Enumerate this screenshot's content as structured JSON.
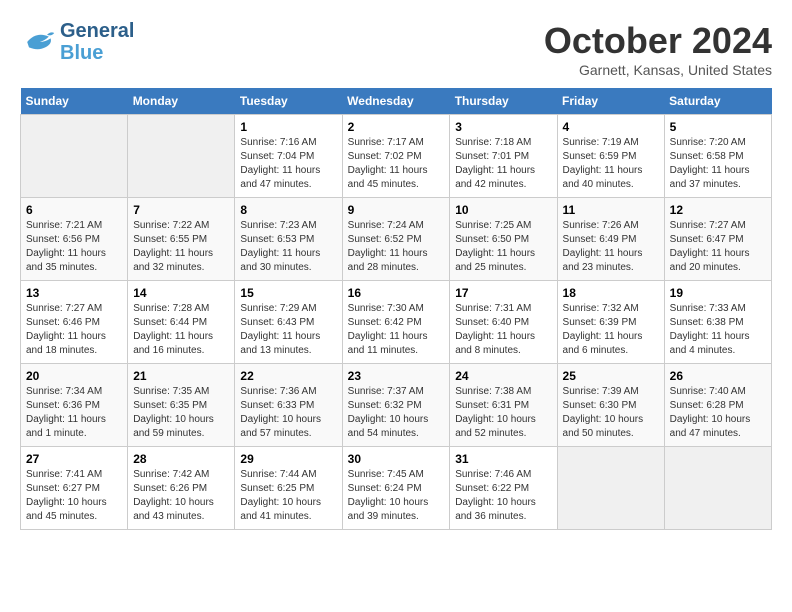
{
  "header": {
    "logo": {
      "line1": "General",
      "line2": "Blue"
    },
    "title": "October 2024",
    "location": "Garnett, Kansas, United States"
  },
  "days_of_week": [
    "Sunday",
    "Monday",
    "Tuesday",
    "Wednesday",
    "Thursday",
    "Friday",
    "Saturday"
  ],
  "weeks": [
    [
      {
        "day": "",
        "sunrise": "",
        "sunset": "",
        "daylight": ""
      },
      {
        "day": "",
        "sunrise": "",
        "sunset": "",
        "daylight": ""
      },
      {
        "day": "1",
        "sunrise": "Sunrise: 7:16 AM",
        "sunset": "Sunset: 7:04 PM",
        "daylight": "Daylight: 11 hours and 47 minutes."
      },
      {
        "day": "2",
        "sunrise": "Sunrise: 7:17 AM",
        "sunset": "Sunset: 7:02 PM",
        "daylight": "Daylight: 11 hours and 45 minutes."
      },
      {
        "day": "3",
        "sunrise": "Sunrise: 7:18 AM",
        "sunset": "Sunset: 7:01 PM",
        "daylight": "Daylight: 11 hours and 42 minutes."
      },
      {
        "day": "4",
        "sunrise": "Sunrise: 7:19 AM",
        "sunset": "Sunset: 6:59 PM",
        "daylight": "Daylight: 11 hours and 40 minutes."
      },
      {
        "day": "5",
        "sunrise": "Sunrise: 7:20 AM",
        "sunset": "Sunset: 6:58 PM",
        "daylight": "Daylight: 11 hours and 37 minutes."
      }
    ],
    [
      {
        "day": "6",
        "sunrise": "Sunrise: 7:21 AM",
        "sunset": "Sunset: 6:56 PM",
        "daylight": "Daylight: 11 hours and 35 minutes."
      },
      {
        "day": "7",
        "sunrise": "Sunrise: 7:22 AM",
        "sunset": "Sunset: 6:55 PM",
        "daylight": "Daylight: 11 hours and 32 minutes."
      },
      {
        "day": "8",
        "sunrise": "Sunrise: 7:23 AM",
        "sunset": "Sunset: 6:53 PM",
        "daylight": "Daylight: 11 hours and 30 minutes."
      },
      {
        "day": "9",
        "sunrise": "Sunrise: 7:24 AM",
        "sunset": "Sunset: 6:52 PM",
        "daylight": "Daylight: 11 hours and 28 minutes."
      },
      {
        "day": "10",
        "sunrise": "Sunrise: 7:25 AM",
        "sunset": "Sunset: 6:50 PM",
        "daylight": "Daylight: 11 hours and 25 minutes."
      },
      {
        "day": "11",
        "sunrise": "Sunrise: 7:26 AM",
        "sunset": "Sunset: 6:49 PM",
        "daylight": "Daylight: 11 hours and 23 minutes."
      },
      {
        "day": "12",
        "sunrise": "Sunrise: 7:27 AM",
        "sunset": "Sunset: 6:47 PM",
        "daylight": "Daylight: 11 hours and 20 minutes."
      }
    ],
    [
      {
        "day": "13",
        "sunrise": "Sunrise: 7:27 AM",
        "sunset": "Sunset: 6:46 PM",
        "daylight": "Daylight: 11 hours and 18 minutes."
      },
      {
        "day": "14",
        "sunrise": "Sunrise: 7:28 AM",
        "sunset": "Sunset: 6:44 PM",
        "daylight": "Daylight: 11 hours and 16 minutes."
      },
      {
        "day": "15",
        "sunrise": "Sunrise: 7:29 AM",
        "sunset": "Sunset: 6:43 PM",
        "daylight": "Daylight: 11 hours and 13 minutes."
      },
      {
        "day": "16",
        "sunrise": "Sunrise: 7:30 AM",
        "sunset": "Sunset: 6:42 PM",
        "daylight": "Daylight: 11 hours and 11 minutes."
      },
      {
        "day": "17",
        "sunrise": "Sunrise: 7:31 AM",
        "sunset": "Sunset: 6:40 PM",
        "daylight": "Daylight: 11 hours and 8 minutes."
      },
      {
        "day": "18",
        "sunrise": "Sunrise: 7:32 AM",
        "sunset": "Sunset: 6:39 PM",
        "daylight": "Daylight: 11 hours and 6 minutes."
      },
      {
        "day": "19",
        "sunrise": "Sunrise: 7:33 AM",
        "sunset": "Sunset: 6:38 PM",
        "daylight": "Daylight: 11 hours and 4 minutes."
      }
    ],
    [
      {
        "day": "20",
        "sunrise": "Sunrise: 7:34 AM",
        "sunset": "Sunset: 6:36 PM",
        "daylight": "Daylight: 11 hours and 1 minute."
      },
      {
        "day": "21",
        "sunrise": "Sunrise: 7:35 AM",
        "sunset": "Sunset: 6:35 PM",
        "daylight": "Daylight: 10 hours and 59 minutes."
      },
      {
        "day": "22",
        "sunrise": "Sunrise: 7:36 AM",
        "sunset": "Sunset: 6:33 PM",
        "daylight": "Daylight: 10 hours and 57 minutes."
      },
      {
        "day": "23",
        "sunrise": "Sunrise: 7:37 AM",
        "sunset": "Sunset: 6:32 PM",
        "daylight": "Daylight: 10 hours and 54 minutes."
      },
      {
        "day": "24",
        "sunrise": "Sunrise: 7:38 AM",
        "sunset": "Sunset: 6:31 PM",
        "daylight": "Daylight: 10 hours and 52 minutes."
      },
      {
        "day": "25",
        "sunrise": "Sunrise: 7:39 AM",
        "sunset": "Sunset: 6:30 PM",
        "daylight": "Daylight: 10 hours and 50 minutes."
      },
      {
        "day": "26",
        "sunrise": "Sunrise: 7:40 AM",
        "sunset": "Sunset: 6:28 PM",
        "daylight": "Daylight: 10 hours and 47 minutes."
      }
    ],
    [
      {
        "day": "27",
        "sunrise": "Sunrise: 7:41 AM",
        "sunset": "Sunset: 6:27 PM",
        "daylight": "Daylight: 10 hours and 45 minutes."
      },
      {
        "day": "28",
        "sunrise": "Sunrise: 7:42 AM",
        "sunset": "Sunset: 6:26 PM",
        "daylight": "Daylight: 10 hours and 43 minutes."
      },
      {
        "day": "29",
        "sunrise": "Sunrise: 7:44 AM",
        "sunset": "Sunset: 6:25 PM",
        "daylight": "Daylight: 10 hours and 41 minutes."
      },
      {
        "day": "30",
        "sunrise": "Sunrise: 7:45 AM",
        "sunset": "Sunset: 6:24 PM",
        "daylight": "Daylight: 10 hours and 39 minutes."
      },
      {
        "day": "31",
        "sunrise": "Sunrise: 7:46 AM",
        "sunset": "Sunset: 6:22 PM",
        "daylight": "Daylight: 10 hours and 36 minutes."
      },
      {
        "day": "",
        "sunrise": "",
        "sunset": "",
        "daylight": ""
      },
      {
        "day": "",
        "sunrise": "",
        "sunset": "",
        "daylight": ""
      }
    ]
  ]
}
